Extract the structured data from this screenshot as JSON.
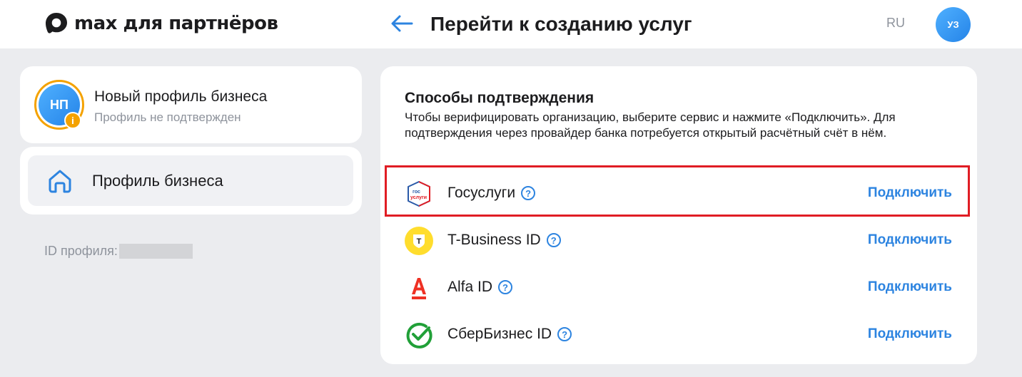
{
  "header": {
    "logo_text": "max для партнёров",
    "title": "Перейти к созданию услуг",
    "language": "RU",
    "user_initials": "УЗ"
  },
  "profile": {
    "initials": "НП",
    "name": "Новый профиль бизнеса",
    "status": "Профиль не подтвержден",
    "badge_icon": "info-icon"
  },
  "nav": {
    "items": [
      {
        "label": "Профиль бизнеса",
        "icon": "home-icon"
      }
    ]
  },
  "profile_id": {
    "label": "ID профиля:"
  },
  "verification": {
    "title": "Способы подтверждения",
    "description": "Чтобы верифицировать организацию, выберите сервис и нажмите «Подключить». Для подтверждения через провайдер банка потребуется открытый расчётный счёт в нём.",
    "methods": [
      {
        "name": "Госуслуги",
        "action": "Подключить",
        "icon": "gosuslugi-logo",
        "highlighted": true
      },
      {
        "name": "T-Business ID",
        "action": "Подключить",
        "icon": "tbank-logo"
      },
      {
        "name": "Alfa ID",
        "action": "Подключить",
        "icon": "alfa-logo"
      },
      {
        "name": "СберБизнес ID",
        "action": "Подключить",
        "icon": "sber-logo"
      }
    ],
    "gosuslugi_logo_text": [
      "гос",
      "услуги"
    ],
    "tbank_logo_text": "T"
  },
  "colors": {
    "accent": "#2d84e0",
    "highlight": "#e01d24",
    "warning": "#f4a200",
    "alfa": "#ef3124",
    "sber": "#21a038",
    "tbank": "#ffdd2d"
  }
}
